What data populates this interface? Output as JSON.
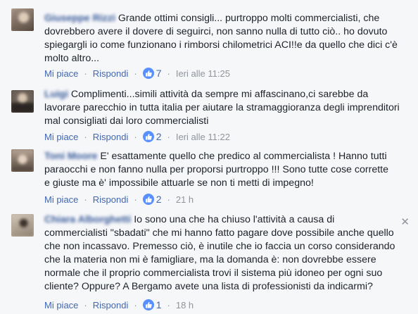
{
  "comments": [
    {
      "author": "Giuseppe Rizzi",
      "text_lines": [
        "Grande ottimi consigli... purtroppo molti commercialisti, che",
        "dovrebbero avere il dovere di seguirci, non sanno nulla di tutto ciò.. ho dovuto",
        "spiegargli io come funzionano i rimborsi chilometrici ACI!!e da quello che dici c'è",
        "molto altro..."
      ],
      "like_label": "Mi piace",
      "reply_label": "Rispondi",
      "likes": "7",
      "time": "Ieri alle 11:25"
    },
    {
      "author": "Luigi",
      "text_lines": [
        "Complimenti...simili attività da sempre mi affascinano,ci sarebbe da",
        "lavorare parecchio in tutta italia per aiutare la stramaggioranza degli imprenditori",
        "mal consigliati dai loro commercialisti"
      ],
      "like_label": "Mi piace",
      "reply_label": "Rispondi",
      "likes": "2",
      "time": "Ieri alle 11:22"
    },
    {
      "author": "Toni Moore",
      "text_lines": [
        "E' esattamente quello che predico al commercialista ! Hanno tutti",
        "paraocchi e non fanno nulla per proporsi purtroppo !!! Sono tutte cose corrette",
        "e giuste ma è' impossibile attuarle se non ti metti di impegno!"
      ],
      "like_label": "Mi piace",
      "reply_label": "Rispondi",
      "likes": "2",
      "time": "21 h"
    },
    {
      "author": "Chiara Alborghetti",
      "text_lines": [
        "Io sono una che ha chiuso l'attività a causa di",
        "commercialisti \"sbadati\" che mi hanno fatto pagare dove possibile anche quello",
        "che non incassavo. Premesso ciò, è inutile che io faccia un corso considerando",
        "che la materia non mi è famigliare, ma la domanda è: non dovrebbe essere",
        "normale che il proprio commercialista trovi il sistema più idoneo per ogni suo",
        "cliente? Oppure? A Bergamo avete una lista di professionisti da indicarmi?"
      ],
      "like_label": "Mi piace",
      "reply_label": "Rispondi",
      "likes": "1",
      "time": "18 h"
    }
  ],
  "icons": {
    "like": "thumbs-up-icon",
    "close": "close-icon"
  },
  "colors": {
    "link": "#4267b2",
    "author": "#365899",
    "meta": "#90949c",
    "like_badge": "#5890ff"
  }
}
